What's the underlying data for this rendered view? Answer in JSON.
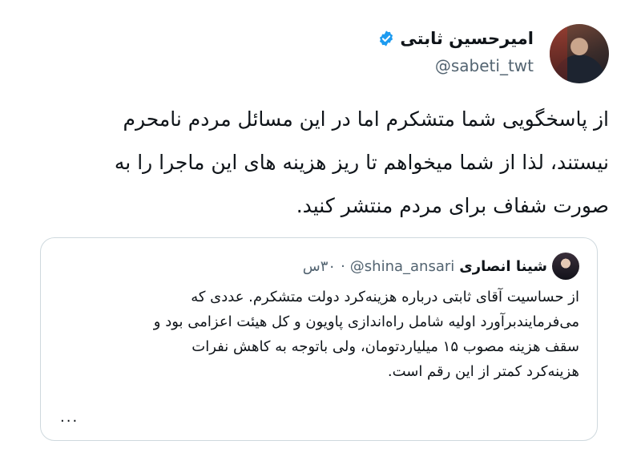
{
  "author": {
    "name": "امیرحسین ثابتی",
    "handle": "@sabeti_twt",
    "verified": true,
    "avatar_icon": "profile-photo",
    "verified_color": "#1d9bf0"
  },
  "tweet": {
    "lines": [
      "از پاسخگویی شما متشکرم اما در این مسائل مردم نامحرم",
      "نیستند، لذا از شما میخواهم تا ریز هزینه های این ماجرا را به",
      "صورت شفاف برای مردم منتشر کنید."
    ]
  },
  "quoted": {
    "name": "شینا انصاری",
    "handle": "@shina_ansari",
    "separator": "·",
    "time": "۳۰س",
    "lines": [
      "از حساسیت آقای ثابتی درباره هزینه‌کرد دولت متشکرم. عددی که",
      "می‌فرمایندبرآورد اولیه شامل راه‌اندازی پاویون و کل هیئت اعزامی بود و",
      "سقف هزینه مصوب ۱۵ میلیاردتومان، ولی باتوجه به کاهش نفرات",
      "هزینه‌کرد کمتر از این رقم است."
    ],
    "more": "..."
  }
}
